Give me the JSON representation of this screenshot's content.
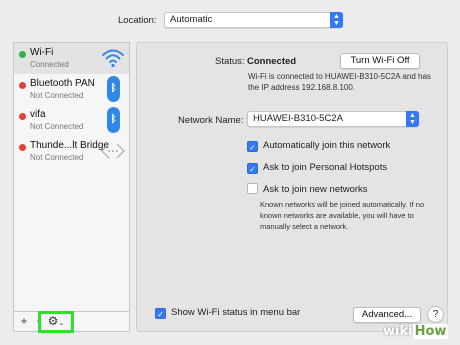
{
  "location": {
    "label": "Location:",
    "value": "Automatic"
  },
  "sidebar": {
    "items": [
      {
        "name": "Wi-Fi",
        "status": "Connected",
        "dot": "green",
        "icon": "wifi-icon"
      },
      {
        "name": "Bluetooth PAN",
        "status": "Not Connected",
        "dot": "red",
        "icon": "bluetooth-icon"
      },
      {
        "name": "vifa",
        "status": "Not Connected",
        "dot": "red",
        "icon": "bluetooth-icon"
      },
      {
        "name": "Thunde...lt Bridge",
        "status": "Not Connected",
        "dot": "red",
        "icon": "thunderbolt-bridge-icon"
      }
    ],
    "footer": {
      "add": "+",
      "remove": "−",
      "gear": "⚙",
      "gear_icon": "gear-icon"
    }
  },
  "main": {
    "status_label": "Status:",
    "status_value": "Connected",
    "turn_off_button": "Turn Wi-Fi Off",
    "status_description": "Wi-Fi is connected to HUAWEI-B310-5C2A and has the IP address 192.168.8.100.",
    "network_name_label": "Network Name:",
    "network_name_value": "HUAWEI-B310-5C2A",
    "options": [
      {
        "label": "Automatically join this network",
        "checked": true
      },
      {
        "label": "Ask to join Personal Hotspots",
        "checked": true
      },
      {
        "label": "Ask to join new networks",
        "checked": false
      }
    ],
    "known_description": "Known networks will be joined automatically. If no known networks are available, you will have to manually select a network.",
    "show_status": {
      "label": "Show Wi-Fi status in menu bar",
      "checked": true
    },
    "advanced_button": "Advanced...",
    "help_button": "?"
  },
  "watermark": {
    "part1": "wiki",
    "part2": "How"
  },
  "colors": {
    "accent": "#3478f6",
    "highlight": "#2fe02f",
    "connected": "#2bb44a",
    "disconnected": "#e2403a"
  }
}
